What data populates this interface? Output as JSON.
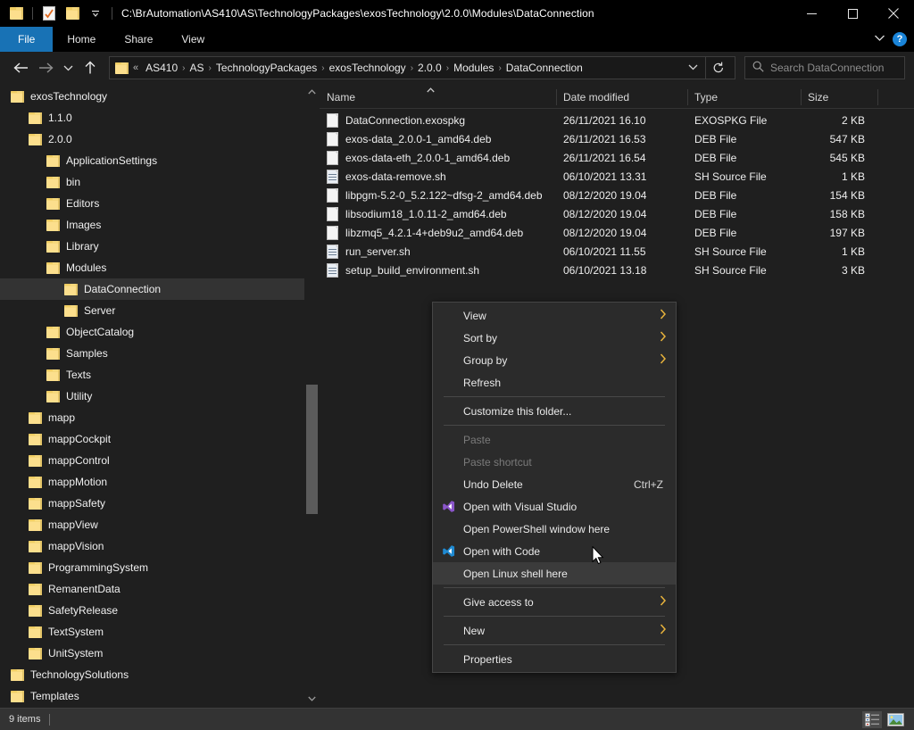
{
  "window": {
    "title": "C:\\BrAutomation\\AS410\\AS\\TechnologyPackages\\exosTechnology\\2.0.0\\Modules\\DataConnection",
    "accent_blue": "#1872b5",
    "background": "#1f1f1f",
    "folder_yellow": "#fcdf8d",
    "quick_access": [
      {
        "name": "folder-icon",
        "label": "Folder"
      },
      {
        "name": "properties-icon",
        "label": "Properties"
      },
      {
        "name": "new-folder-icon",
        "label": "New folder"
      },
      {
        "name": "customize-dropdown-icon",
        "label": "Customize Quick Access Toolbar"
      }
    ],
    "controls": {
      "minimize": "—",
      "maximize": "☐",
      "close": "✕"
    }
  },
  "ribbon": {
    "tabs": [
      {
        "label": "File",
        "active": true
      },
      {
        "label": "Home",
        "active": false
      },
      {
        "label": "Share",
        "active": false
      },
      {
        "label": "View",
        "active": false
      }
    ],
    "expand_label": "˅",
    "help_label": "?"
  },
  "addressbar": {
    "back": "←",
    "forward": "→",
    "recent": "˅",
    "up": "↑",
    "chevrons": "«",
    "crumbs": [
      "AS410",
      "AS",
      "TechnologyPackages",
      "exosTechnology",
      "2.0.0",
      "Modules",
      "DataConnection"
    ],
    "separator": "›",
    "dropdown": "˅",
    "refresh": "↻"
  },
  "search": {
    "placeholder": "Search DataConnection",
    "icon": "search-icon"
  },
  "navpane": {
    "items": [
      {
        "label": "exosTechnology",
        "indent": 0,
        "selected": false
      },
      {
        "label": "1.1.0",
        "indent": 1,
        "selected": false
      },
      {
        "label": "2.0.0",
        "indent": 1,
        "selected": false
      },
      {
        "label": "ApplicationSettings",
        "indent": 2,
        "selected": false
      },
      {
        "label": "bin",
        "indent": 2,
        "selected": false
      },
      {
        "label": "Editors",
        "indent": 2,
        "selected": false
      },
      {
        "label": "Images",
        "indent": 2,
        "selected": false
      },
      {
        "label": "Library",
        "indent": 2,
        "selected": false
      },
      {
        "label": "Modules",
        "indent": 2,
        "selected": false
      },
      {
        "label": "DataConnection",
        "indent": 3,
        "selected": true
      },
      {
        "label": "Server",
        "indent": 3,
        "selected": false
      },
      {
        "label": "ObjectCatalog",
        "indent": 2,
        "selected": false
      },
      {
        "label": "Samples",
        "indent": 2,
        "selected": false
      },
      {
        "label": "Texts",
        "indent": 2,
        "selected": false
      },
      {
        "label": "Utility",
        "indent": 2,
        "selected": false
      },
      {
        "label": "mapp",
        "indent": 1,
        "selected": false
      },
      {
        "label": "mappCockpit",
        "indent": 1,
        "selected": false
      },
      {
        "label": "mappControl",
        "indent": 1,
        "selected": false
      },
      {
        "label": "mappMotion",
        "indent": 1,
        "selected": false
      },
      {
        "label": "mappSafety",
        "indent": 1,
        "selected": false
      },
      {
        "label": "mappView",
        "indent": 1,
        "selected": false
      },
      {
        "label": "mappVision",
        "indent": 1,
        "selected": false
      },
      {
        "label": "ProgrammingSystem",
        "indent": 1,
        "selected": false
      },
      {
        "label": "RemanentData",
        "indent": 1,
        "selected": false
      },
      {
        "label": "SafetyRelease",
        "indent": 1,
        "selected": false
      },
      {
        "label": "TextSystem",
        "indent": 1,
        "selected": false
      },
      {
        "label": "UnitSystem",
        "indent": 1,
        "selected": false
      },
      {
        "label": "TechnologySolutions",
        "indent": 0,
        "selected": false
      },
      {
        "label": "Templates",
        "indent": 0,
        "selected": false
      }
    ],
    "scroll_up": "˄",
    "scroll_down": "˅"
  },
  "filelist": {
    "columns": [
      {
        "label": "Name",
        "sorted": "asc"
      },
      {
        "label": "Date modified",
        "sorted": ""
      },
      {
        "label": "Type",
        "sorted": ""
      },
      {
        "label": "Size",
        "sorted": ""
      }
    ],
    "sort_indicator": "˄",
    "rows": [
      {
        "name": "DataConnection.exospkg",
        "icon": "file-icon",
        "modified": "26/11/2021 16.10",
        "type": "EXOSPKG File",
        "size": "2 KB"
      },
      {
        "name": "exos-data_2.0.0-1_amd64.deb",
        "icon": "file-icon",
        "modified": "26/11/2021 16.53",
        "type": "DEB File",
        "size": "547 KB"
      },
      {
        "name": "exos-data-eth_2.0.0-1_amd64.deb",
        "icon": "file-icon",
        "modified": "26/11/2021 16.54",
        "type": "DEB File",
        "size": "545 KB"
      },
      {
        "name": "exos-data-remove.sh",
        "icon": "sh-source-icon",
        "modified": "06/10/2021 13.31",
        "type": "SH Source File",
        "size": "1 KB"
      },
      {
        "name": "libpgm-5.2-0_5.2.122~dfsg-2_amd64.deb",
        "icon": "file-icon",
        "modified": "08/12/2020 19.04",
        "type": "DEB File",
        "size": "154 KB"
      },
      {
        "name": "libsodium18_1.0.11-2_amd64.deb",
        "icon": "file-icon",
        "modified": "08/12/2020 19.04",
        "type": "DEB File",
        "size": "158 KB"
      },
      {
        "name": "libzmq5_4.2.1-4+deb9u2_amd64.deb",
        "icon": "file-icon",
        "modified": "08/12/2020 19.04",
        "type": "DEB File",
        "size": "197 KB"
      },
      {
        "name": "run_server.sh",
        "icon": "sh-source-icon",
        "modified": "06/10/2021 11.55",
        "type": "SH Source File",
        "size": "1 KB"
      },
      {
        "name": "setup_build_environment.sh",
        "icon": "sh-source-icon",
        "modified": "06/10/2021 13.18",
        "type": "SH Source File",
        "size": "3 KB"
      }
    ]
  },
  "contextmenu": {
    "items": [
      {
        "label": "View",
        "submenu": true,
        "disabled": false,
        "highlighted": false,
        "icon": "",
        "accel": ""
      },
      {
        "label": "Sort by",
        "submenu": true,
        "disabled": false,
        "highlighted": false,
        "icon": "",
        "accel": ""
      },
      {
        "label": "Group by",
        "submenu": true,
        "disabled": false,
        "highlighted": false,
        "icon": "",
        "accel": ""
      },
      {
        "label": "Refresh",
        "submenu": false,
        "disabled": false,
        "highlighted": false,
        "icon": "",
        "accel": ""
      },
      {
        "separator": true
      },
      {
        "label": "Customize this folder...",
        "submenu": false,
        "disabled": false,
        "highlighted": false,
        "icon": "",
        "accel": ""
      },
      {
        "separator": true
      },
      {
        "label": "Paste",
        "submenu": false,
        "disabled": true,
        "highlighted": false,
        "icon": "",
        "accel": ""
      },
      {
        "label": "Paste shortcut",
        "submenu": false,
        "disabled": true,
        "highlighted": false,
        "icon": "",
        "accel": ""
      },
      {
        "label": "Undo Delete",
        "submenu": false,
        "disabled": false,
        "highlighted": false,
        "icon": "",
        "accel": "Ctrl+Z"
      },
      {
        "label": "Open with Visual Studio",
        "submenu": false,
        "disabled": false,
        "highlighted": false,
        "icon": "visual-studio-icon",
        "accel": ""
      },
      {
        "label": "Open PowerShell window here",
        "submenu": false,
        "disabled": false,
        "highlighted": false,
        "icon": "",
        "accel": ""
      },
      {
        "label": "Open with Code",
        "submenu": false,
        "disabled": false,
        "highlighted": false,
        "icon": "vscode-icon",
        "accel": ""
      },
      {
        "label": "Open Linux shell here",
        "submenu": false,
        "disabled": false,
        "highlighted": true,
        "icon": "",
        "accel": ""
      },
      {
        "separator": true
      },
      {
        "label": "Give access to",
        "submenu": true,
        "disabled": false,
        "highlighted": false,
        "icon": "",
        "accel": ""
      },
      {
        "separator": true
      },
      {
        "label": "New",
        "submenu": true,
        "disabled": false,
        "highlighted": false,
        "icon": "",
        "accel": ""
      },
      {
        "separator": true
      },
      {
        "label": "Properties",
        "submenu": false,
        "disabled": false,
        "highlighted": false,
        "icon": "",
        "accel": ""
      }
    ],
    "submenu_arrow": "›"
  },
  "statusbar": {
    "item_count": "9 items",
    "view_details": "details-view-icon",
    "view_large_icons": "large-icons-view-icon"
  }
}
